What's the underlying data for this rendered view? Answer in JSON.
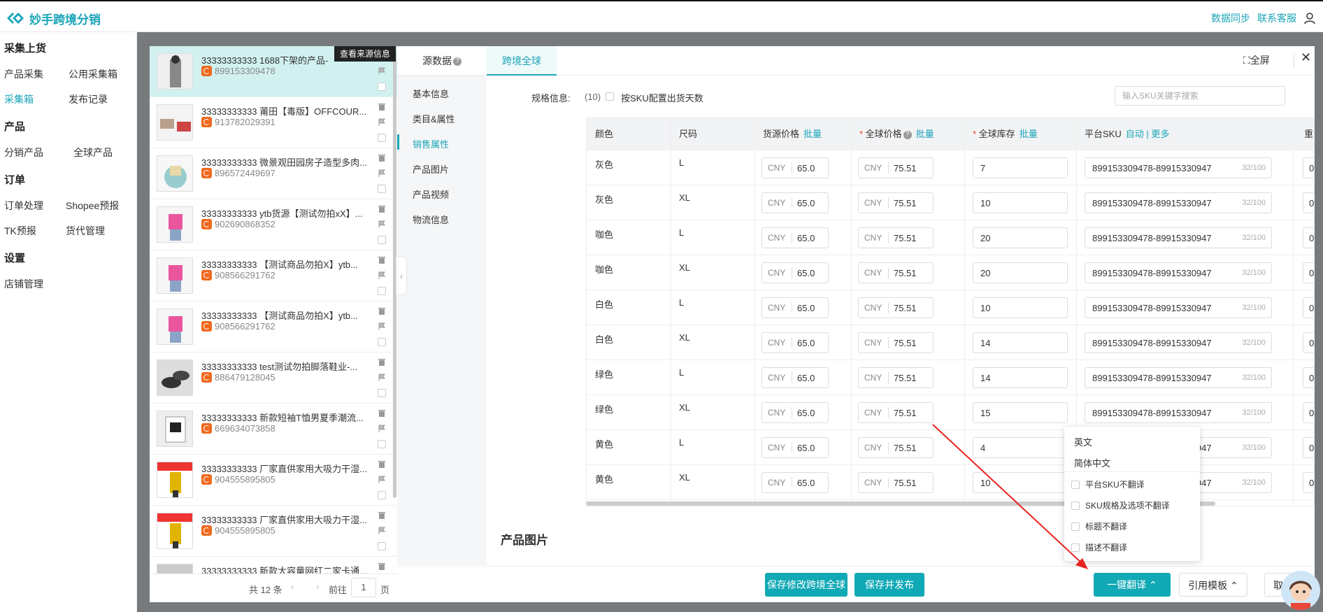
{
  "app": {
    "title": "妙手跨境分销",
    "top_links": [
      "数据同步",
      "联系客服"
    ],
    "brand_color": "#1aa5b8"
  },
  "nav": {
    "groups": [
      {
        "title": "采集上货",
        "items": [
          "产品采集",
          "公用采集箱",
          "采集箱",
          "发布记录"
        ]
      },
      {
        "title": "产品",
        "items": [
          "分销产品",
          "全球产品"
        ]
      },
      {
        "title": "订单",
        "items": [
          "订单处理",
          "Shopee预报",
          "TK预报",
          "货代管理"
        ]
      },
      {
        "title": "设置",
        "items": [
          "店铺管理"
        ]
      }
    ],
    "active": "采集箱"
  },
  "product_list": {
    "tooltip": "查看来源信息",
    "items": [
      {
        "title": "33333333333 1688下架的产品-",
        "id": "899153309478"
      },
      {
        "title": "33333333333 莆田【毒版】OFFCOUR...",
        "id": "913782029391"
      },
      {
        "title": "33333333333 微景观田园房子造型多肉...",
        "id": "896572449697"
      },
      {
        "title": "33333333333 ytb货源【测试勿拍xX】...",
        "id": "902690868352"
      },
      {
        "title": "33333333333 【测试商品勿拍X】ytb...",
        "id": "908566291762"
      },
      {
        "title": "33333333333 【测试商品勿拍X】ytb...",
        "id": "908566291762"
      },
      {
        "title": "33333333333 test测试勿拍脚落鞋业-...",
        "id": "886479128045"
      },
      {
        "title": "33333333333 新款短袖T恤男夏季潮流...",
        "id": "669634073858"
      },
      {
        "title": "33333333333 厂家直供家用大吸力干湿...",
        "id": "904555895805"
      },
      {
        "title": "33333333333 厂家直供家用大吸力干湿...",
        "id": "904555895805"
      },
      {
        "title": "33333333333 新款大容量网红二家卡通...",
        "id": ""
      }
    ],
    "pager": {
      "total": "共 12 条",
      "goto": "前往",
      "page": "1",
      "page_unit": "页"
    }
  },
  "modal": {
    "tabs": [
      "源数据",
      "跨境全球"
    ],
    "active_tab": "跨境全球",
    "fullscreen": "全屏",
    "side_nav": [
      "基本信息",
      "类目&属性",
      "销售属性",
      "产品图片",
      "产品视频",
      "物流信息"
    ],
    "active_side": "销售属性",
    "spec": {
      "label": "规格信息:",
      "count": "(10)",
      "checkbox_label": "按SKU配置出货天数",
      "search_placeholder": "输入SKU关键字搜索"
    },
    "table": {
      "headers": {
        "color": "颜色",
        "size": "尺码",
        "source_price": "货源价格",
        "global_price": "全球价格",
        "global_stock": "全球库存",
        "platform_sku": "平台SKU",
        "weight": "重"
      },
      "batch": "批量",
      "auto": "自动",
      "more": "更多",
      "currency": "CNY",
      "sku_counter": "32/100",
      "rows": [
        {
          "color": "灰色",
          "size": "L",
          "source_price": "65.0",
          "global_price": "75.51",
          "stock": "7",
          "sku": "899153309478-89915330947",
          "weight": "0"
        },
        {
          "color": "灰色",
          "size": "XL",
          "source_price": "65.0",
          "global_price": "75.51",
          "stock": "10",
          "sku": "899153309478-89915330947",
          "weight": "0"
        },
        {
          "color": "咖色",
          "size": "L",
          "source_price": "65.0",
          "global_price": "75.51",
          "stock": "20",
          "sku": "899153309478-89915330947",
          "weight": "0"
        },
        {
          "color": "咖色",
          "size": "XL",
          "source_price": "65.0",
          "global_price": "75.51",
          "stock": "20",
          "sku": "899153309478-89915330947",
          "weight": "0"
        },
        {
          "color": "白色",
          "size": "L",
          "source_price": "65.0",
          "global_price": "75.51",
          "stock": "10",
          "sku": "899153309478-89915330947",
          "weight": "0"
        },
        {
          "color": "白色",
          "size": "XL",
          "source_price": "65.0",
          "global_price": "75.51",
          "stock": "14",
          "sku": "899153309478-89915330947",
          "weight": "0"
        },
        {
          "color": "绿色",
          "size": "L",
          "source_price": "65.0",
          "global_price": "75.51",
          "stock": "14",
          "sku": "899153309478-89915330947",
          "weight": "0"
        },
        {
          "color": "绿色",
          "size": "XL",
          "source_price": "65.0",
          "global_price": "75.51",
          "stock": "15",
          "sku": "899153309478-89915330947",
          "weight": "0"
        },
        {
          "color": "黄色",
          "size": "L",
          "source_price": "65.0",
          "global_price": "75.51",
          "stock": "4",
          "sku": "899153309478-89915330947",
          "weight": "0"
        },
        {
          "color": "黄色",
          "size": "XL",
          "source_price": "65.0",
          "global_price": "75.51",
          "stock": "10",
          "sku": "899153309478-89915330947",
          "weight": "0"
        }
      ]
    },
    "section_title": "产品图片",
    "footer": {
      "save_global": "保存修改跨境全球",
      "save_publish": "保存并发布",
      "translate": "一键翻译",
      "template": "引用模板",
      "cancel": "取"
    },
    "translate_menu": {
      "languages": [
        "英文",
        "简体中文"
      ],
      "options": [
        "平台SKU不翻译",
        "SKU规格及选项不翻译",
        "标题不翻译",
        "描述不翻译"
      ]
    }
  }
}
